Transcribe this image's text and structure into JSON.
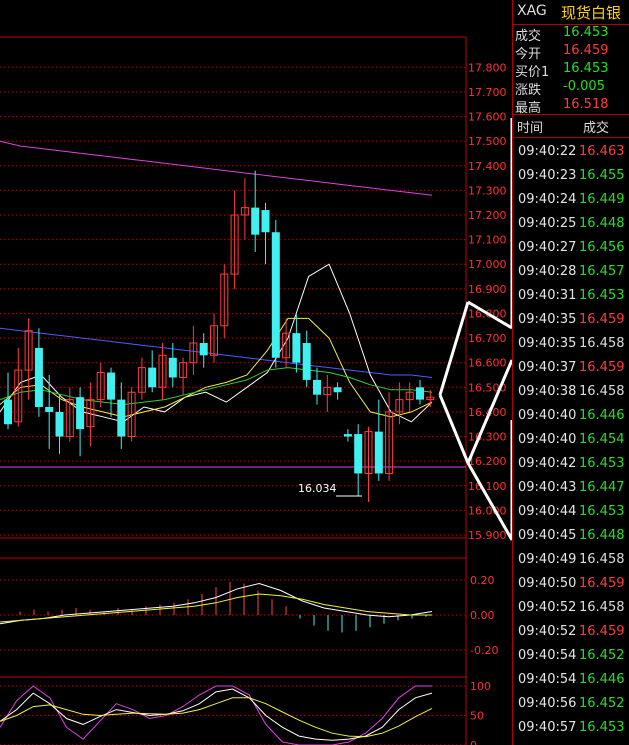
{
  "quote": {
    "symbol": "XAG",
    "name": "现货白银",
    "fields": [
      {
        "label": "成交",
        "value": "16.453",
        "color": "#22e022"
      },
      {
        "label": "今开",
        "value": "16.459",
        "color": "#ff3b3b"
      },
      {
        "label": "买价1",
        "value": "16.453",
        "color": "#22e022"
      },
      {
        "label": "涨跌",
        "value": "-0.005",
        "color": "#22e022"
      },
      {
        "label": "最高",
        "value": "16.518",
        "color": "#ff3b3b"
      }
    ]
  },
  "ticks_header": {
    "time": "时间",
    "price": "成交"
  },
  "ticks": [
    {
      "time": "09:40:22",
      "price": "16.463",
      "dir": "up"
    },
    {
      "time": "09:40:23",
      "price": "16.455",
      "dir": "dn"
    },
    {
      "time": "09:40:24",
      "price": "16.449",
      "dir": "dn"
    },
    {
      "time": "09:40:25",
      "price": "16.448",
      "dir": "dn"
    },
    {
      "time": "09:40:27",
      "price": "16.456",
      "dir": "dn"
    },
    {
      "time": "09:40:28",
      "price": "16.457",
      "dir": "dn"
    },
    {
      "time": "09:40:31",
      "price": "16.453",
      "dir": "dn"
    },
    {
      "time": "09:40:35",
      "price": "16.459",
      "dir": "up"
    },
    {
      "time": "09:40:35",
      "price": "16.458",
      "dir": "eq"
    },
    {
      "time": "09:40:37",
      "price": "16.459",
      "dir": "up"
    },
    {
      "time": "09:40:38",
      "price": "16.458",
      "dir": "eq"
    },
    {
      "time": "09:40:40",
      "price": "16.446",
      "dir": "dn"
    },
    {
      "time": "09:40:40",
      "price": "16.454",
      "dir": "dn"
    },
    {
      "time": "09:40:42",
      "price": "16.453",
      "dir": "dn"
    },
    {
      "time": "09:40:43",
      "price": "16.447",
      "dir": "dn"
    },
    {
      "time": "09:40:44",
      "price": "16.453",
      "dir": "dn"
    },
    {
      "time": "09:40:45",
      "price": "16.448",
      "dir": "dn"
    },
    {
      "time": "09:40:49",
      "price": "16.458",
      "dir": "eq"
    },
    {
      "time": "09:40:50",
      "price": "16.459",
      "dir": "up"
    },
    {
      "time": "09:40:52",
      "price": "16.458",
      "dir": "eq"
    },
    {
      "time": "09:40:52",
      "price": "16.459",
      "dir": "up"
    },
    {
      "time": "09:40:54",
      "price": "16.452",
      "dir": "dn"
    },
    {
      "time": "09:40:54",
      "price": "16.446",
      "dir": "dn"
    },
    {
      "time": "09:40:56",
      "price": "16.452",
      "dir": "dn"
    },
    {
      "time": "09:40:57",
      "price": "16.453",
      "dir": "dn"
    }
  ],
  "chart_data": [
    {
      "type": "candlestick",
      "ylim": [
        15.9,
        17.85
      ],
      "yticks": [
        "17.800",
        "17.700",
        "17.600",
        "17.500",
        "17.400",
        "17.300",
        "17.200",
        "17.100",
        "17.000",
        "16.900",
        "16.800",
        "16.700",
        "16.600",
        "16.500",
        "16.400",
        "16.300",
        "16.200",
        "16.100",
        "16.000",
        "15.900"
      ],
      "annotation": "16.034",
      "candles": [
        {
          "o": 16.45,
          "h": 16.56,
          "l": 16.33,
          "c": 16.35
        },
        {
          "o": 16.36,
          "h": 16.66,
          "l": 16.34,
          "c": 16.57
        },
        {
          "o": 16.57,
          "h": 16.78,
          "l": 16.45,
          "c": 16.73
        },
        {
          "o": 16.66,
          "h": 16.74,
          "l": 16.38,
          "c": 16.42
        },
        {
          "o": 16.42,
          "h": 16.55,
          "l": 16.25,
          "c": 16.4
        },
        {
          "o": 16.4,
          "h": 16.47,
          "l": 16.23,
          "c": 16.3
        },
        {
          "o": 16.3,
          "h": 16.5,
          "l": 16.28,
          "c": 16.45
        },
        {
          "o": 16.46,
          "h": 16.5,
          "l": 16.22,
          "c": 16.33
        },
        {
          "o": 16.34,
          "h": 16.52,
          "l": 16.26,
          "c": 16.45
        },
        {
          "o": 16.45,
          "h": 16.6,
          "l": 16.42,
          "c": 16.56
        },
        {
          "o": 16.56,
          "h": 16.58,
          "l": 16.38,
          "c": 16.45
        },
        {
          "o": 16.45,
          "h": 16.52,
          "l": 16.25,
          "c": 16.3
        },
        {
          "o": 16.3,
          "h": 16.5,
          "l": 16.28,
          "c": 16.48
        },
        {
          "o": 16.48,
          "h": 16.62,
          "l": 16.45,
          "c": 16.58
        },
        {
          "o": 16.58,
          "h": 16.65,
          "l": 16.48,
          "c": 16.5
        },
        {
          "o": 16.5,
          "h": 16.68,
          "l": 16.45,
          "c": 16.63
        },
        {
          "o": 16.62,
          "h": 16.68,
          "l": 16.5,
          "c": 16.54
        },
        {
          "o": 16.54,
          "h": 16.62,
          "l": 16.47,
          "c": 16.6
        },
        {
          "o": 16.6,
          "h": 16.75,
          "l": 16.55,
          "c": 16.68
        },
        {
          "o": 16.68,
          "h": 16.72,
          "l": 16.58,
          "c": 16.63
        },
        {
          "o": 16.63,
          "h": 16.8,
          "l": 16.6,
          "c": 16.75
        },
        {
          "o": 16.75,
          "h": 17.0,
          "l": 16.7,
          "c": 16.96
        },
        {
          "o": 16.96,
          "h": 17.3,
          "l": 16.9,
          "c": 17.2
        },
        {
          "o": 17.2,
          "h": 17.35,
          "l": 17.1,
          "c": 17.23
        },
        {
          "o": 17.23,
          "h": 17.38,
          "l": 17.05,
          "c": 17.12
        },
        {
          "o": 17.22,
          "h": 17.25,
          "l": 17.0,
          "c": 17.13
        },
        {
          "o": 17.13,
          "h": 17.18,
          "l": 16.58,
          "c": 16.62
        },
        {
          "o": 16.62,
          "h": 16.78,
          "l": 16.58,
          "c": 16.72
        },
        {
          "o": 16.72,
          "h": 16.8,
          "l": 16.56,
          "c": 16.6
        },
        {
          "o": 16.68,
          "h": 16.73,
          "l": 16.5,
          "c": 16.53
        },
        {
          "o": 16.53,
          "h": 16.58,
          "l": 16.43,
          "c": 16.47
        },
        {
          "o": 16.47,
          "h": 16.55,
          "l": 16.4,
          "c": 16.5
        },
        {
          "o": 16.5,
          "h": 16.52,
          "l": 16.45,
          "c": 16.48
        },
        {
          "o": 16.31,
          "h": 16.33,
          "l": 16.28,
          "c": 16.3
        },
        {
          "o": 16.31,
          "h": 16.35,
          "l": 16.06,
          "c": 16.15
        },
        {
          "o": 16.15,
          "h": 16.34,
          "l": 16.034,
          "c": 16.32
        },
        {
          "o": 16.32,
          "h": 16.45,
          "l": 16.12,
          "c": 16.15
        },
        {
          "o": 16.15,
          "h": 16.48,
          "l": 16.12,
          "c": 16.4
        },
        {
          "o": 16.4,
          "h": 16.52,
          "l": 16.35,
          "c": 16.45
        },
        {
          "o": 16.45,
          "h": 16.52,
          "l": 16.4,
          "c": 16.48
        },
        {
          "o": 16.5,
          "h": 16.53,
          "l": 16.43,
          "c": 16.45
        },
        {
          "o": 16.45,
          "h": 16.49,
          "l": 16.42,
          "c": 16.46
        }
      ],
      "overlays": [
        {
          "color": "#e040e0",
          "values": [
            17.5,
            17.48,
            17.47,
            17.46,
            17.45,
            17.44,
            17.43,
            17.42,
            17.41,
            17.4,
            17.39,
            17.38,
            17.37,
            17.36,
            17.35,
            17.34,
            17.33,
            17.32,
            17.31,
            17.3,
            17.29,
            17.28
          ]
        },
        {
          "color": "#4a5cff",
          "values": [
            16.74,
            16.73,
            16.72,
            16.71,
            16.7,
            16.69,
            16.68,
            16.67,
            16.66,
            16.65,
            16.64,
            16.63,
            16.62,
            16.61,
            16.6,
            16.59,
            16.58,
            16.57,
            16.56,
            16.55,
            16.55,
            16.54
          ]
        },
        {
          "color": "#ffffff",
          "values": [
            16.4,
            16.52,
            16.55,
            16.46,
            16.4,
            16.38,
            16.36,
            16.42,
            16.4,
            16.46,
            16.48,
            16.44,
            16.5,
            16.56,
            16.7,
            16.95,
            17.0,
            16.8,
            16.55,
            16.4,
            16.36,
            16.44
          ]
        },
        {
          "color": "#f0f040",
          "values": [
            16.43,
            16.5,
            16.51,
            16.45,
            16.42,
            16.4,
            16.38,
            16.4,
            16.42,
            16.46,
            16.5,
            16.52,
            16.55,
            16.65,
            16.78,
            16.78,
            16.7,
            16.52,
            16.4,
            16.38,
            16.4,
            16.44
          ]
        },
        {
          "color": "#30d030",
          "values": [
            16.45,
            16.48,
            16.49,
            16.47,
            16.45,
            16.44,
            16.43,
            16.44,
            16.45,
            16.47,
            16.49,
            16.51,
            16.53,
            16.57,
            16.58,
            16.57,
            16.56,
            16.54,
            16.51,
            16.49,
            16.49,
            16.48
          ]
        }
      ]
    },
    {
      "type": "macd",
      "ylim": [
        -0.2,
        0.2
      ],
      "yticks": [
        "0.20",
        "0.00",
        "-0.20"
      ],
      "histogram": [
        0.02,
        0.03,
        0.02,
        0.03,
        0.04,
        0.03,
        0.02,
        0.04,
        0.03,
        0.05,
        0.06,
        0.07,
        0.09,
        0.12,
        0.16,
        0.19,
        0.18,
        0.14,
        0.09,
        0.05,
        -0.02,
        -0.06,
        -0.09,
        -0.1,
        -0.09,
        -0.07,
        -0.05,
        -0.03,
        -0.02,
        -0.01
      ],
      "dif": [
        -0.05,
        -0.03,
        -0.02,
        0.0,
        0.01,
        0.02,
        0.03,
        0.04,
        0.05,
        0.07,
        0.1,
        0.15,
        0.18,
        0.14,
        0.08,
        0.04,
        0.02,
        0.0,
        -0.01,
        0.0,
        0.02
      ],
      "dea": [
        -0.04,
        -0.03,
        -0.02,
        -0.01,
        0.0,
        0.01,
        0.02,
        0.03,
        0.04,
        0.05,
        0.07,
        0.1,
        0.12,
        0.11,
        0.09,
        0.06,
        0.04,
        0.02,
        0.01,
        0.0,
        0.0
      ]
    },
    {
      "type": "kdj",
      "ylim": [
        0,
        100
      ],
      "yticks": [
        "100",
        "50",
        "0"
      ],
      "k": [
        40,
        60,
        88,
        70,
        45,
        35,
        48,
        60,
        55,
        50,
        52,
        58,
        70,
        90,
        95,
        80,
        50,
        30,
        15,
        10,
        8,
        10,
        15,
        30,
        60,
        80,
        88
      ],
      "d": [
        40,
        50,
        65,
        68,
        60,
        52,
        50,
        52,
        54,
        53,
        52,
        54,
        60,
        70,
        80,
        80,
        70,
        56,
        42,
        30,
        20,
        15,
        14,
        20,
        32,
        48,
        62
      ],
      "j": [
        30,
        75,
        100,
        80,
        30,
        10,
        40,
        70,
        60,
        45,
        50,
        65,
        85,
        100,
        100,
        85,
        35,
        5,
        0,
        0,
        0,
        5,
        20,
        45,
        80,
        100,
        100
      ]
    }
  ]
}
